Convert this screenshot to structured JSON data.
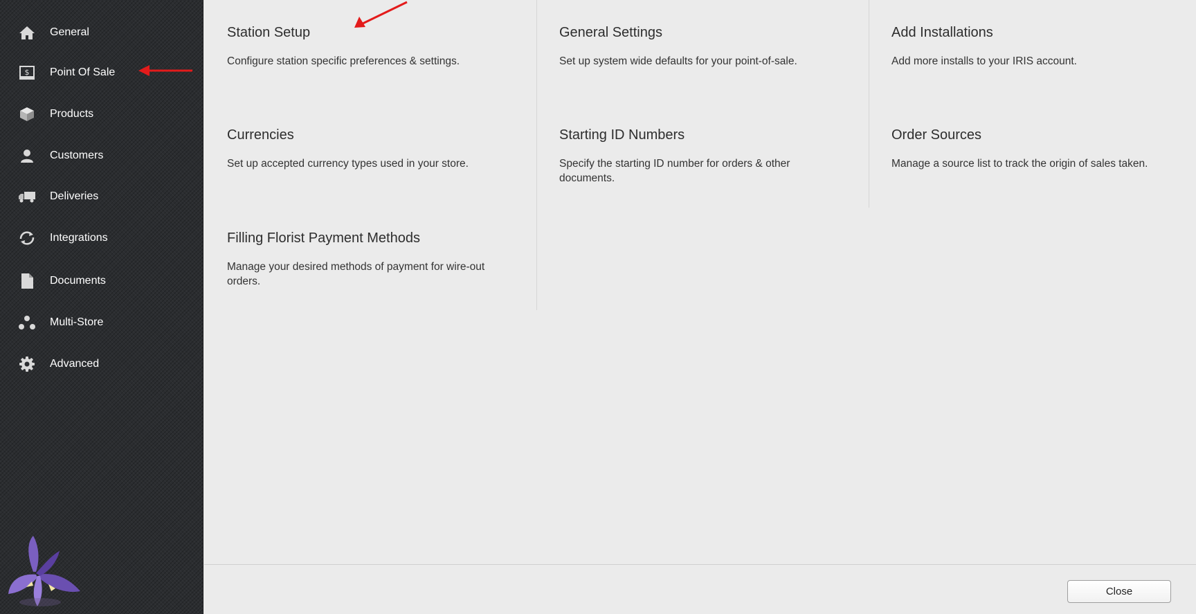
{
  "sidebar": {
    "items": [
      {
        "label": "General",
        "icon": "home-icon"
      },
      {
        "label": "Point Of Sale",
        "icon": "register-icon"
      },
      {
        "label": "Products",
        "icon": "box-icon"
      },
      {
        "label": "Customers",
        "icon": "person-icon"
      },
      {
        "label": "Deliveries",
        "icon": "truck-icon"
      },
      {
        "label": "Integrations",
        "icon": "sync-icon"
      },
      {
        "label": "Documents",
        "icon": "document-icon"
      },
      {
        "label": "Multi-Store",
        "icon": "multi-store-icon"
      },
      {
        "label": "Advanced",
        "icon": "gear-icon"
      }
    ]
  },
  "tiles": [
    {
      "title": "Station Setup",
      "description": "Configure station specific preferences & settings."
    },
    {
      "title": "General Settings",
      "description": "Set up system wide defaults for your point-of-sale."
    },
    {
      "title": "Add Installations",
      "description": "Add more installs to your IRIS account."
    },
    {
      "title": "Currencies",
      "description": "Set up accepted currency types used in your store."
    },
    {
      "title": "Starting ID Numbers",
      "description": "Specify the starting ID number for orders & other documents."
    },
    {
      "title": "Order Sources",
      "description": "Manage a source list to track the origin of sales taken."
    },
    {
      "title": "Filling Florist Payment Methods",
      "description": "Manage your desired methods of payment for wire-out orders."
    }
  ],
  "footer": {
    "close_label": "Close"
  },
  "colors": {
    "sidebar_bg": "#2b2d30",
    "panel_bg": "#ebebeb",
    "annotation_arrow": "#e31b1b"
  }
}
